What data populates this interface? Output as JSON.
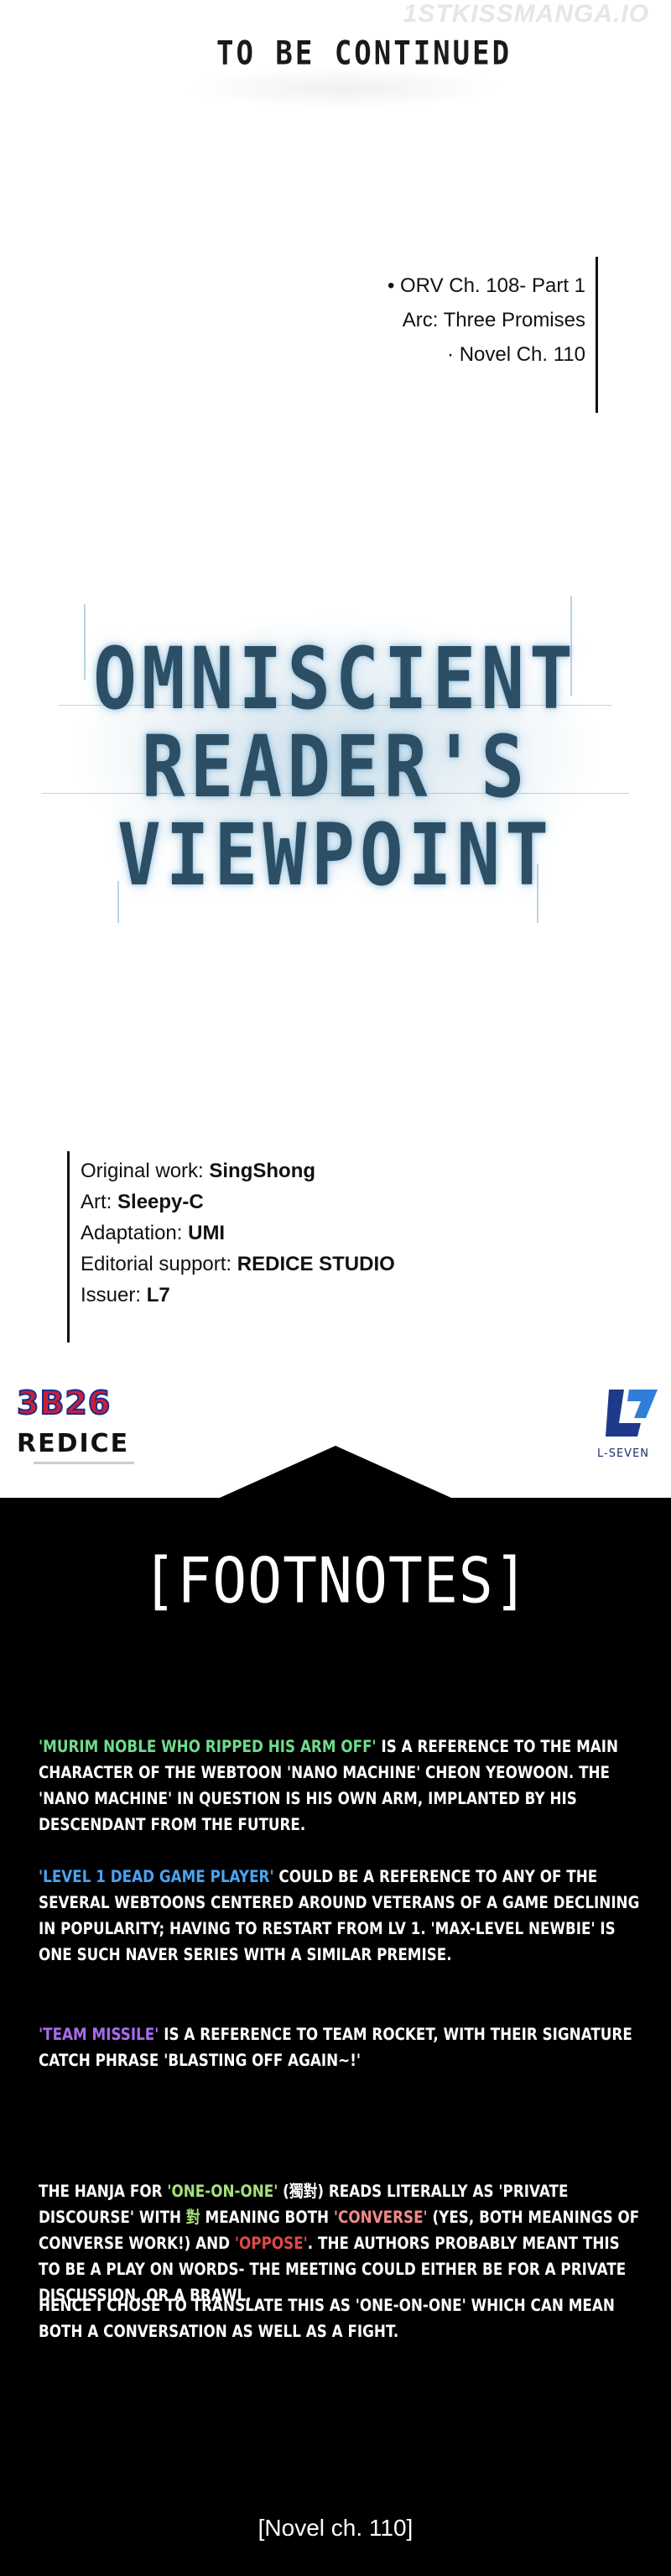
{
  "watermark": "1STKISSMANGA.IO",
  "to_be_continued": "TO BE CONTINUED",
  "chapter_info": {
    "line1": "• ORV Ch. 108- Part 1",
    "line2": "Arc: Three Promises",
    "line3": "· Novel Ch. 110"
  },
  "logo": {
    "line1": "OMNISCIENT",
    "line2": "READER'S",
    "line3": "VIEWPOINT"
  },
  "credits": [
    {
      "label": "Original work: ",
      "value": "SingShong"
    },
    {
      "label": "Art: ",
      "value": "Sleepy-C"
    },
    {
      "label": "Adaptation: ",
      "value": "UMI"
    },
    {
      "label": "Editorial support: ",
      "value": "REDICE STUDIO"
    },
    {
      "label": "Issuer: ",
      "value": "L7"
    }
  ],
  "publisher_logos": {
    "logo_3b26": "3B26",
    "logo_redice": "REDICE",
    "lseven_label": "L-SEVEN"
  },
  "footnotes": {
    "title": "[FOOTNOTES]",
    "note1": {
      "highlight": "'MURIM NOBLE WHO RIPPED HIS ARM OFF'",
      "text": " IS A REFERENCE TO THE MAIN CHARACTER OF THE WEBTOON 'NANO MACHINE' CHEON YEOWOON. THE 'NANO MACHINE' IN QUESTION IS HIS OWN ARM, IMPLANTED BY HIS DESCENDANT FROM THE FUTURE."
    },
    "note2": {
      "highlight": "'LEVEL 1 DEAD GAME PLAYER'",
      "text": " COULD BE A REFERENCE TO ANY OF THE SEVERAL WEBTOONS CENTERED AROUND VETERANS OF A GAME DECLINING IN POPULARITY; HAVING TO RESTART FROM LV 1. 'MAX-LEVEL NEWBIE' IS ONE SUCH NAVER SERIES WITH A SIMILAR PREMISE."
    },
    "note3": {
      "highlight": "'TEAM MISSILE'",
      "text": " IS A REFERENCE TO TEAM ROCKET, WITH THEIR SIGNATURE CATCH PHRASE 'BLASTING OFF AGAIN~!'"
    },
    "note4": {
      "p1": "THE HANJA FOR ",
      "h1": "'ONE-ON-ONE'",
      "p2": " (獨對) READS LITERALLY AS 'PRIVATE DISCOURSE' WITH ",
      "h2": "對",
      "p3": " MEANING BOTH ",
      "h3": "'CONVERSE'",
      "p4": " (YES, BOTH MEANINGS OF CONVERSE WORK!) AND ",
      "h4": "'OPPOSE'",
      "p5": ". THE AUTHORS PROBABLY MEANT THIS TO BE A PLAY ON WORDS- THE MEETING COULD EITHER BE FOR A PRIVATE DISCUSSION, OR A BRAWL."
    },
    "note5": "HENCE I CHOSE TO TRANSLATE THIS AS 'ONE-ON-ONE' WHICH CAN MEAN BOTH A CONVERSATION AS WELL AS A FIGHT.",
    "novel_ref": "[Novel ch. 110]"
  },
  "colors": {
    "green": "#6fdc8c",
    "blue": "#4aa3f0",
    "purple": "#a86bf0",
    "lime": "#a6e07a",
    "pink": "#f08a8a",
    "red": "#e04848"
  }
}
